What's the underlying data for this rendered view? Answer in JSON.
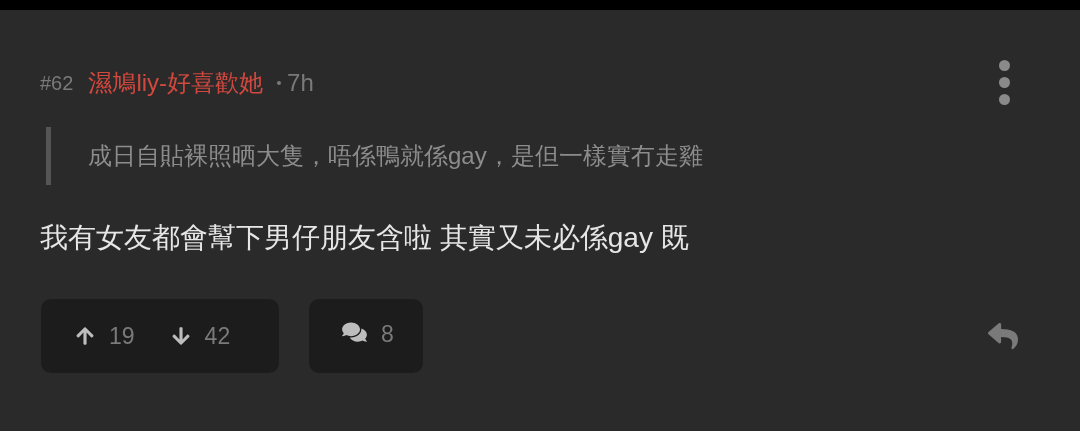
{
  "post": {
    "number": "#62",
    "author": "濕鳩liy-好喜歡她",
    "time": "7h",
    "quote": "成日自貼裸照晒大隻，唔係鴨就係gay，是但一樣實冇走雞",
    "body": "我有女友都會幫下男仔朋友含啦 其實又未必係gay 既",
    "upvotes": "19",
    "downvotes": "42",
    "replies": "8"
  }
}
